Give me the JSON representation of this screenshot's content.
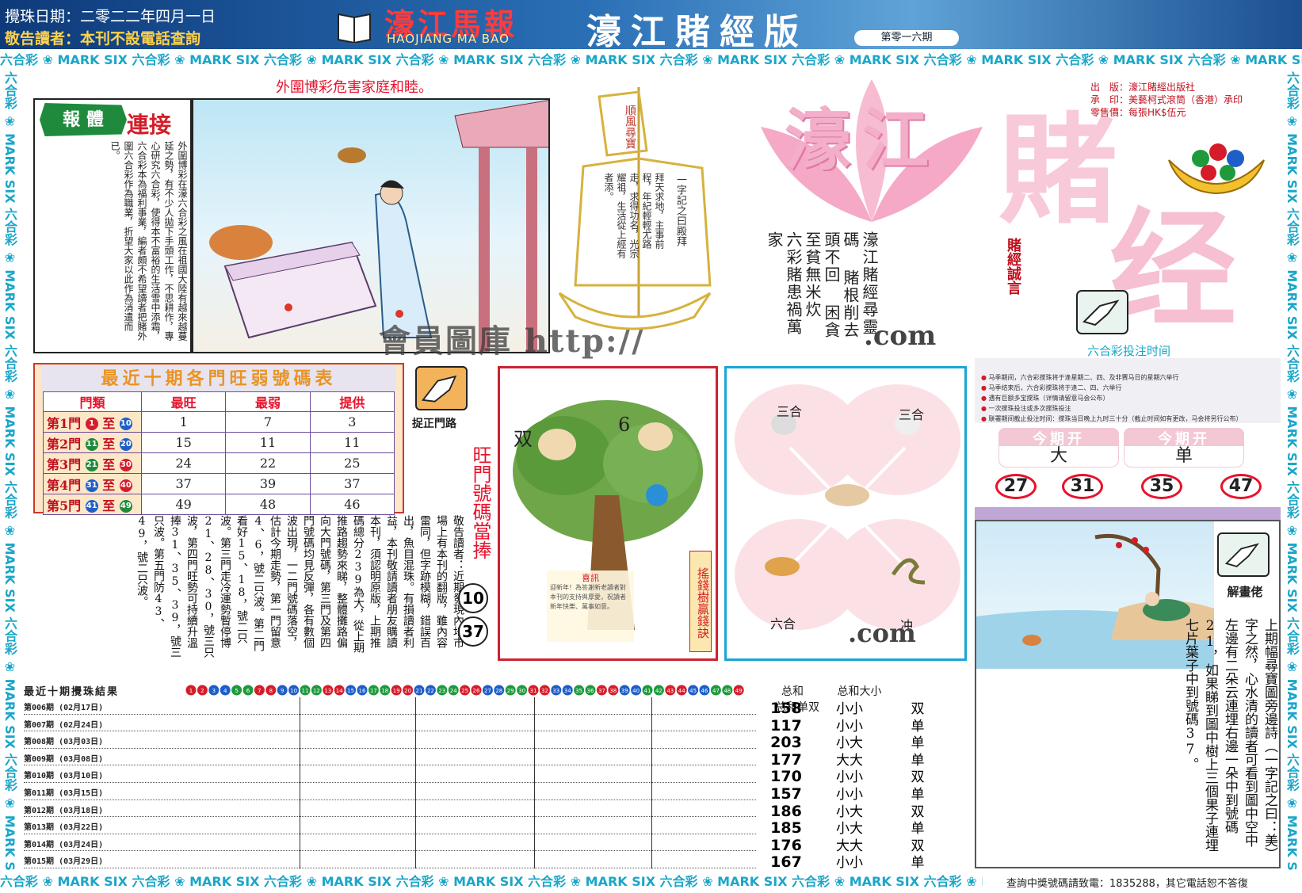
{
  "header": {
    "draw_date": "攪珠日期：二零二二年四月一日",
    "notice": "敬告讀者：本刊不設電話查詢",
    "masthead": "濠江馬報",
    "masthead_en": "HAOJIANG MA BAO",
    "edition": "濠江賭經版",
    "issue": "第零一六期"
  },
  "border_strip": "六合彩 ❀ MARK SIX 六合彩 ❀ MARK SIX 六合彩 ❀ MARK SIX 六合彩 ❀ MARK SIX 六合彩 ❀ MARK SIX 六合彩 ❀ MARK SIX 六合彩 ❀ MARK SIX 六合彩 ❀ MARK SIX 六合彩 ❀ MARK SIX 六合彩 ❀ MARK SIX",
  "headline": "外圍博彩危害家庭和睦。",
  "story": {
    "badge": "報 體",
    "heading": "連接",
    "body": "外圍博彩在濠六合彩之風在祖國大陸有越來越蔓延之勢，有不少人拋下手頭工作，不思耕作，專心研究六合彩，使得本不富裕的生活雪中添霜，六合彩本為福利事業，編者頗不希望讀者把賭外圍六合彩作為職業，折望大家以此作為消遣而已。"
  },
  "watermarks": {
    "w1": "會員圖庫 http://",
    "w2": ".com",
    "w3": ".com"
  },
  "sail": {
    "title": "順風尋寶",
    "poem_a": "拜天求地，主事前程，年紀輕輕尤路走，求得功名，光宗耀祖，生活從上經有者添。",
    "poem_b": "一字記之曰殿拜"
  },
  "big_logo": {
    "a": "濠江",
    "b": "賭",
    "c": "经"
  },
  "publisher": [
    "出　版：濠江賭經出版社",
    "承　印：美藝柯式滾筒（香港）承印",
    "零售價：每張HK$伍元"
  ],
  "motto": {
    "lines": [
      "六彩賭患禍萬家",
      "困貪至貧無米炊",
      "賭根削去頭不回",
      "濠江賭經尋靈碼"
    ],
    "label": "賭經誠言"
  },
  "stats": {
    "title": "最近十期各門旺弱號碼表",
    "headers": [
      "門類",
      "最旺",
      "最弱",
      "提供"
    ],
    "rows": [
      {
        "gate": "第1門",
        "from": "1",
        "to": "10",
        "from_c": "r",
        "to_c": "b",
        "hot": "1",
        "cold": "7",
        "pick": "3"
      },
      {
        "gate": "第2門",
        "from": "11",
        "to": "20",
        "from_c": "g",
        "to_c": "b",
        "hot": "15",
        "cold": "11",
        "pick": "11"
      },
      {
        "gate": "第3門",
        "from": "21",
        "to": "30",
        "from_c": "g",
        "to_c": "r",
        "hot": "24",
        "cold": "22",
        "pick": "25"
      },
      {
        "gate": "第4門",
        "from": "31",
        "to": "40",
        "from_c": "b",
        "to_c": "r",
        "hot": "37",
        "cold": "39",
        "pick": "37"
      },
      {
        "gate": "第5門",
        "from": "41",
        "to": "49",
        "from_c": "b",
        "to_c": "g",
        "hot": "49",
        "cold": "48",
        "pick": "46"
      }
    ],
    "connector": "至"
  },
  "ref_label": "捉正門路",
  "article": "敬告讀者：近期發現內地市場上有本刊的翻版，雖內容雷同，但字跡模糊，錯誤百出，魚目混珠。有損讀者利益，本刊敬請讀者朋友購讀本刊，須認明原版，上期推碼總分239為大，從上期推路趨勢來睇，整體攤路偏向大門號碼，第三門及第四門號碼均見反彈，各有數個波出現，一二門號碼落空，估計今期走勢，第一門留意4、6，號二只波。第二門看好15、18，號二只波。第三門走冷運勢暫停博21、28、30，號三只波，第四門旺勢可持續升溫捧31、35、39，號三只波。第五門防43、49，號二只波。",
  "wang": {
    "label": "旺門號碼當捧",
    "n1": "10",
    "n2": "37"
  },
  "tree": {
    "left": "双",
    "right": "6",
    "caption": "搖錢樹贏錢訣",
    "note_title": "喜訊",
    "note_body": "迎新年！為答謝新老讀者對本刊的支持與厚愛，祝讀者新年快樂、萬事如意。"
  },
  "zodiac": {
    "tl": "三合",
    "tr": "三合",
    "bl": "六合",
    "br": "冲"
  },
  "timing": {
    "title": "六合彩投注时间",
    "items": [
      "马季期间，六合彩搅珠将于逢星期二、四、及非赛马日的星期六举行",
      "马季结束后，六合彩搅珠将于逢二、四、六举行",
      "遇有巨额多宝搅珠（详情请留意马会公布）",
      "一次搅珠投注或多次搅珠投注",
      "联署期间截止投注时间：搅珠当日晚上九时三十分（截止时间如有更改，马会将另行公布）"
    ]
  },
  "this_issue": {
    "label": "今期开",
    "big_small": "大",
    "odd_even": "单",
    "numbers": [
      "27",
      "31",
      "35",
      "47"
    ]
  },
  "riddle": {
    "label": "解畫佬",
    "text": "上期幅尋寶圖旁邊詩（一字記之曰：美）字之然，心水清的讀者可看到圖中空中左邊有二朵云連埋右邊一朵中到號碼21，如果睇到圖中樹上三個果子連埋七片葉子中到號碼37。"
  },
  "results": {
    "title": "最近十期攪珠結果",
    "ball_row": [
      "1",
      "2",
      "3",
      "4",
      "5",
      "6",
      "7",
      "8",
      "9",
      "10",
      "11",
      "12",
      "13",
      "14",
      "15",
      "16",
      "17",
      "18",
      "19",
      "20",
      "21",
      "22",
      "23",
      "24",
      "25",
      "26",
      "27",
      "28",
      "29",
      "30",
      "31",
      "32",
      "33",
      "34",
      "35",
      "36",
      "37",
      "38",
      "39",
      "40",
      "41",
      "42",
      "43",
      "44",
      "45",
      "46",
      "47",
      "48",
      "49"
    ],
    "col_headers": [
      "总和",
      "总和大小",
      "总和单双"
    ],
    "rows": [
      {
        "label": "第006期 (02月17日)",
        "sum": "158",
        "size": "小",
        "parity": "双"
      },
      {
        "label": "第007期 (02月24日)",
        "sum": "117",
        "size": "小",
        "parity": "单"
      },
      {
        "label": "第008期 (03月03日)",
        "sum": "203",
        "size": "大",
        "parity": "单"
      },
      {
        "label": "第009期 (03月08日)",
        "sum": "177",
        "size": "大",
        "parity": "单"
      },
      {
        "label": "第010期 (03月10日)",
        "sum": "170",
        "size": "小",
        "parity": "双"
      },
      {
        "label": "第011期 (03月15日)",
        "sum": "157",
        "size": "小",
        "parity": "单"
      },
      {
        "label": "第012期 (03月18日)",
        "sum": "186",
        "size": "大",
        "parity": "双"
      },
      {
        "label": "第013期 (03月22日)",
        "sum": "185",
        "size": "大",
        "parity": "单"
      },
      {
        "label": "第014期 (03月24日)",
        "sum": "176",
        "size": "大",
        "parity": "双"
      },
      {
        "label": "第015期 (03月29日)",
        "sum": "167",
        "size": "小",
        "parity": "单"
      }
    ],
    "size_prefix": [
      "小",
      "小",
      "小",
      "大",
      "小",
      "小",
      "小",
      "小",
      "大",
      "小"
    ]
  },
  "contact": "查詢中獎號碼請致電：1835288，其它電話恕不答復"
}
